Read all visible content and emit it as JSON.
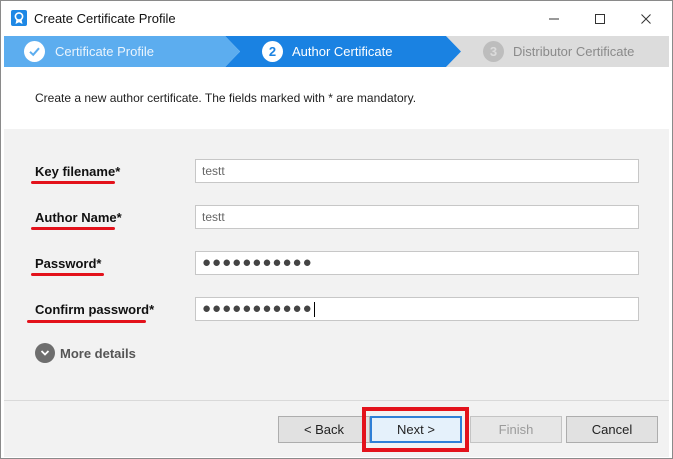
{
  "window": {
    "title": "Create Certificate Profile",
    "controls": {
      "minimize": "minimize-icon",
      "maximize": "maximize-icon",
      "close": "close-icon"
    }
  },
  "steps": [
    {
      "label": "Certificate Profile",
      "marker": "check-icon",
      "state": "completed"
    },
    {
      "label": "Author Certificate",
      "number": "2",
      "state": "active"
    },
    {
      "label": "Distributor Certificate",
      "number": "3",
      "state": "pending"
    }
  ],
  "description": "Create a new author certificate. The fields marked with * are mandatory.",
  "form": {
    "key_filename": {
      "label": "Key filename*",
      "value": "testt"
    },
    "author_name": {
      "label": "Author Name*",
      "value": "testt"
    },
    "password": {
      "label": "Password*",
      "value": "●●●●●●●●●●●"
    },
    "confirm_password": {
      "label": "Confirm password*",
      "value": "●●●●●●●●●●●"
    }
  },
  "more_details": {
    "label": "More details",
    "icon": "chevron-down-icon"
  },
  "buttons": {
    "back": "< Back",
    "next": "Next >",
    "finish": "Finish",
    "cancel": "Cancel"
  },
  "colors": {
    "step_completed": "#5cadef",
    "step_active": "#1a82e2",
    "step_pending": "#dcdcdc",
    "annotation_red": "#e3121b"
  }
}
